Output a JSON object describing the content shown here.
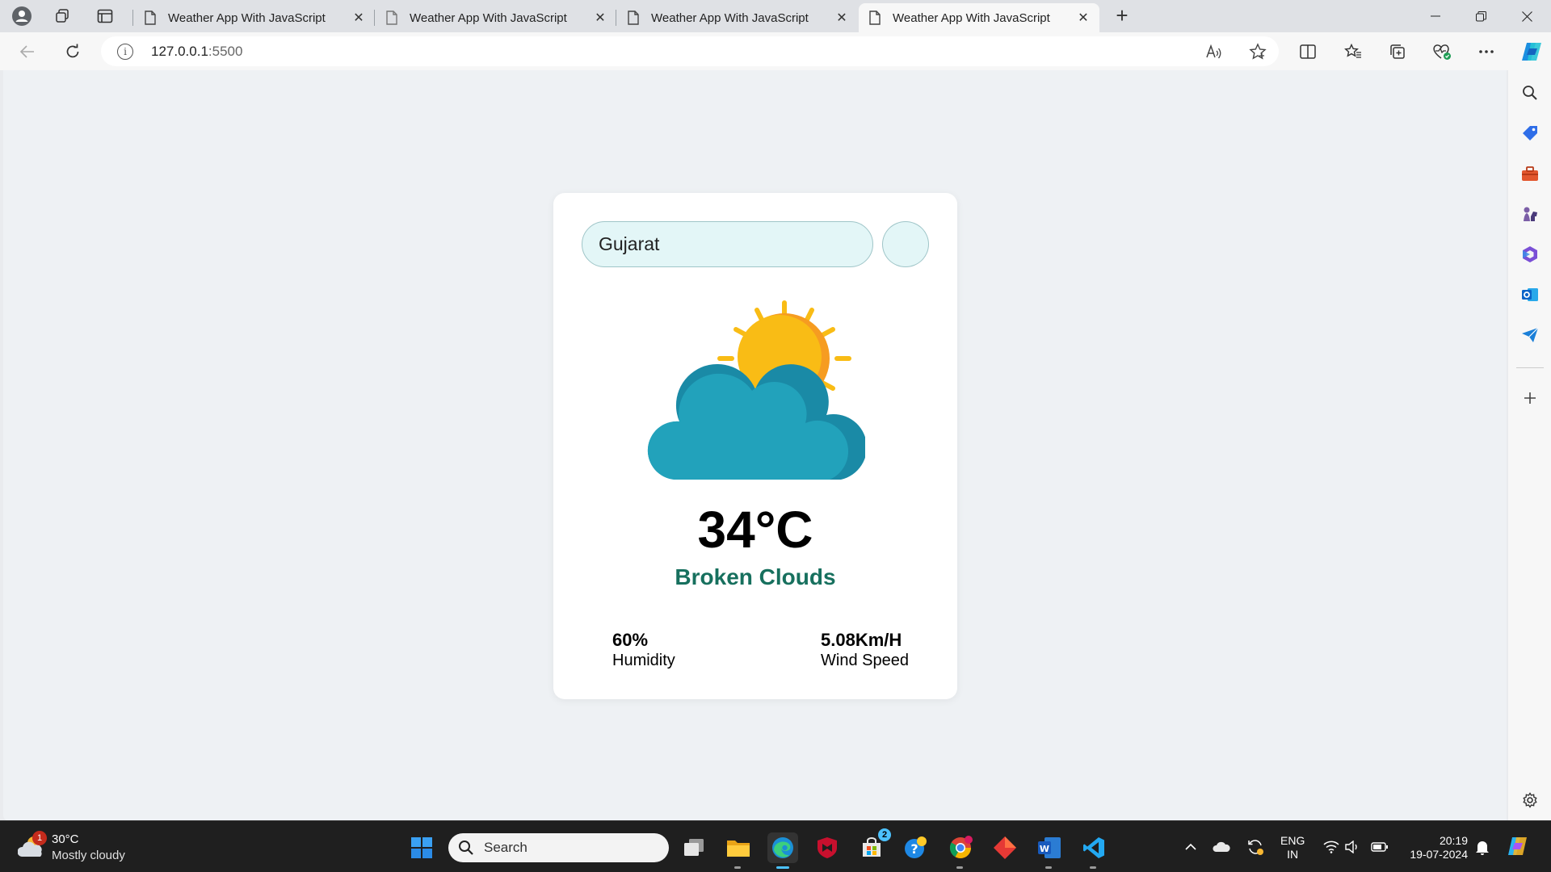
{
  "browser": {
    "tabs": [
      {
        "title": "Weather App With JavaScript",
        "active": false
      },
      {
        "title": "Weather App With JavaScript",
        "active": false
      },
      {
        "title": "Weather App With JavaScript",
        "active": false
      },
      {
        "title": "Weather App With JavaScript",
        "active": true
      }
    ],
    "close_glyph": "✕",
    "new_tab_glyph": "+",
    "url_host": "127.0.0.1",
    "url_port": ":5500",
    "win_minimize": "—",
    "win_restore": "❐",
    "win_close": "✕"
  },
  "app": {
    "search_value": "Gujarat",
    "temperature": "34°C",
    "description": "Broken Clouds",
    "humidity_value": "60%",
    "humidity_label": "Humidity",
    "wind_value": "5.08Km/H",
    "wind_label": "Wind Speed",
    "colors": {
      "description": "#17705e",
      "input_bg": "#e3f6f7",
      "sun": "#f9bc15",
      "cloud": "#22a2bb"
    }
  },
  "taskbar": {
    "weather_temp": "30°C",
    "weather_text": "Mostly cloudy",
    "weather_badge": "1",
    "search_label": "Search",
    "store_badge": "2",
    "lang_top": "ENG",
    "lang_bottom": "IN",
    "time": "20:19",
    "date": "19-07-2024"
  }
}
